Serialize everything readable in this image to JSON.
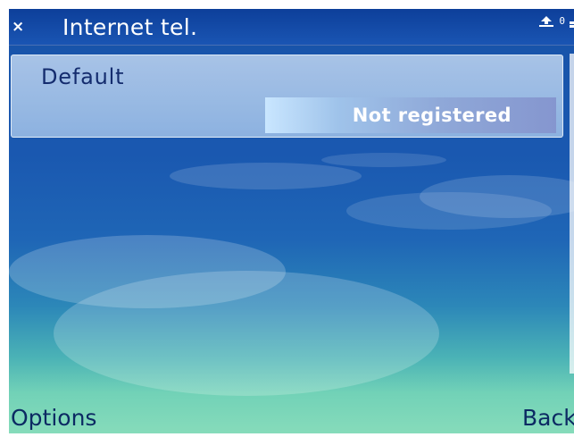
{
  "titlebar": {
    "title": "Internet tel.",
    "close_glyph": "×",
    "status_icon": "upload-arrow-icon",
    "status_counter": "0"
  },
  "services": [
    {
      "name": "Default",
      "status": "Not registered"
    }
  ],
  "softkeys": {
    "left": "Options",
    "right": "Back"
  },
  "colors": {
    "title_bar": "#1a55b3",
    "list_item_bg": "#b4cdeb",
    "service_text": "#142c6e",
    "softkey_text": "#0c2a63",
    "background_top": "#1752a8",
    "background_bottom": "#88dcbb"
  }
}
